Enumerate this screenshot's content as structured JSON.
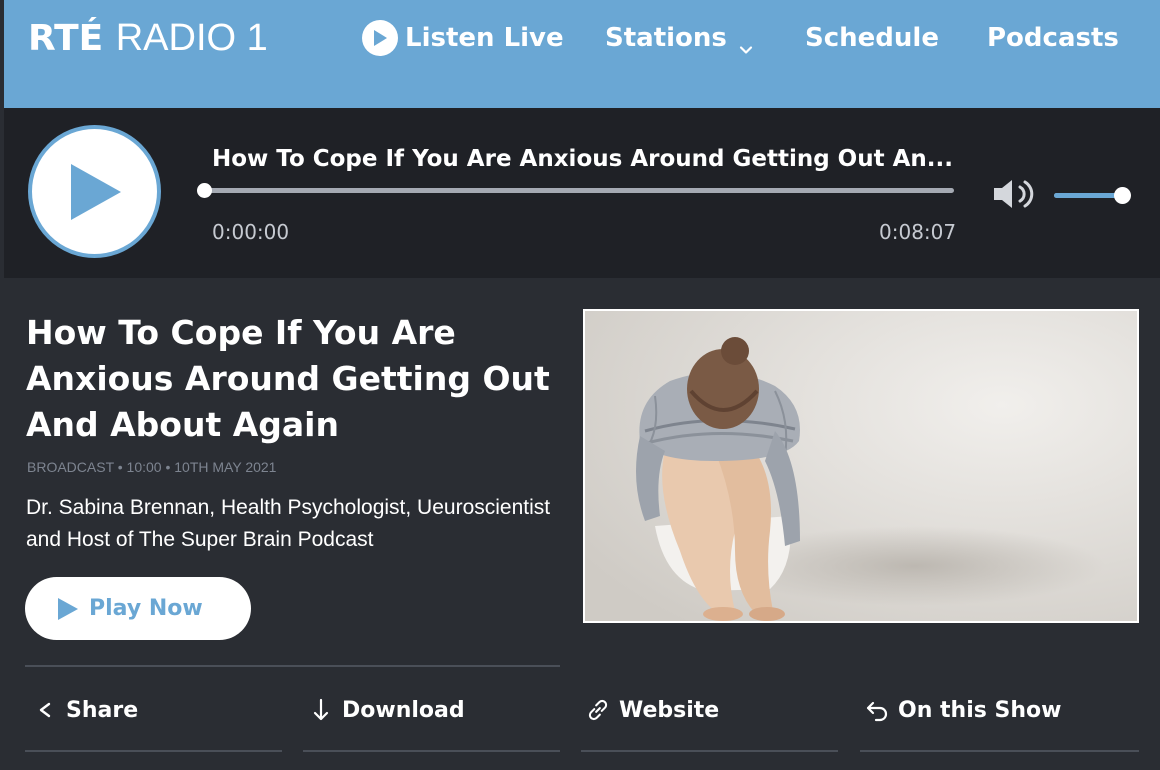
{
  "nav": {
    "logo_rte": "RTÉ",
    "logo_radio": "RADIO 1",
    "listen_live": "Listen Live",
    "stations": "Stations",
    "schedule": "Schedule",
    "podcasts": "Podcasts",
    "background_color": "#6aa7d4"
  },
  "player": {
    "title": "How To Cope If You Are Anxious Around Getting Out An...",
    "time_elapsed": "0:00:00",
    "time_total": "0:08:07",
    "progress_fraction": 0.0,
    "volume_fraction": 1.0,
    "play_icon": "play-icon",
    "volume_icon": "volume-icon"
  },
  "episode": {
    "title": "How To Cope If You Are Anxious Around Getting Out And About Again",
    "meta": "BROADCAST • 10:00 • 10TH MAY 2021",
    "description": "Dr. Sabina Brennan, Health Psychologist, Ueuroscientist and Host of The Super Brain Podcast",
    "play_now": "Play Now"
  },
  "actions": {
    "share": "Share",
    "download": "Download",
    "website": "Website",
    "on_this_show": "On this Show"
  },
  "colors": {
    "accent": "#6aa7d4",
    "background": "#2a2d33",
    "player_bg": "#1f2126"
  }
}
